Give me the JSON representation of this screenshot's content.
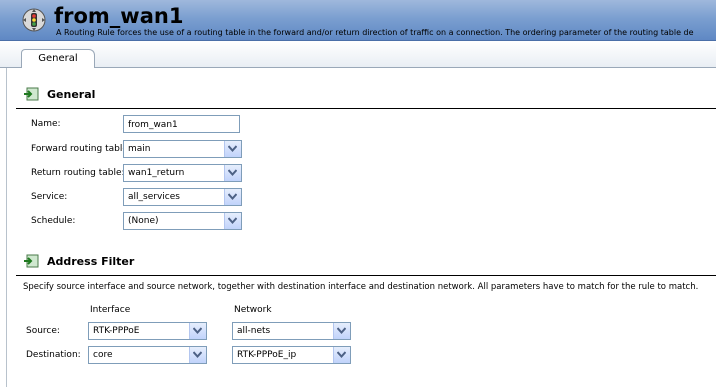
{
  "header": {
    "title": "from_wan1",
    "description": "A Routing Rule forces the use of a routing table in the forward and/or return direction of traffic on a connection. The ordering parameter of the routing table de",
    "icon": "traffic-light-gear-icon"
  },
  "tabs": [
    {
      "label": "General",
      "active": true
    }
  ],
  "general": {
    "title": "General",
    "icon": "section-arrow-icon",
    "fields": {
      "name_label": "Name:",
      "name_value": "from_wan1",
      "forward_label": "Forward routing table:",
      "forward_value": "main",
      "return_label": "Return routing table:",
      "return_value": "wan1_return",
      "service_label": "Service:",
      "service_value": "all_services",
      "schedule_label": "Schedule:",
      "schedule_value": "(None)"
    }
  },
  "address_filter": {
    "title": "Address Filter",
    "icon": "section-arrow-icon",
    "description": "Specify source interface and source network, together with destination interface and destination network. All parameters have to match for the rule to match.",
    "col_interface": "Interface",
    "col_network": "Network",
    "source_label": "Source:",
    "source_interface": "RTK-PPPoE",
    "source_network": "all-nets",
    "destination_label": "Destination:",
    "destination_interface": "core",
    "destination_network": "RTK-PPPoE_ip"
  },
  "colors": {
    "header_blue": "#7b9fd0",
    "input_border": "#7f9db9",
    "dropdown_arrow": "#4d6185"
  }
}
